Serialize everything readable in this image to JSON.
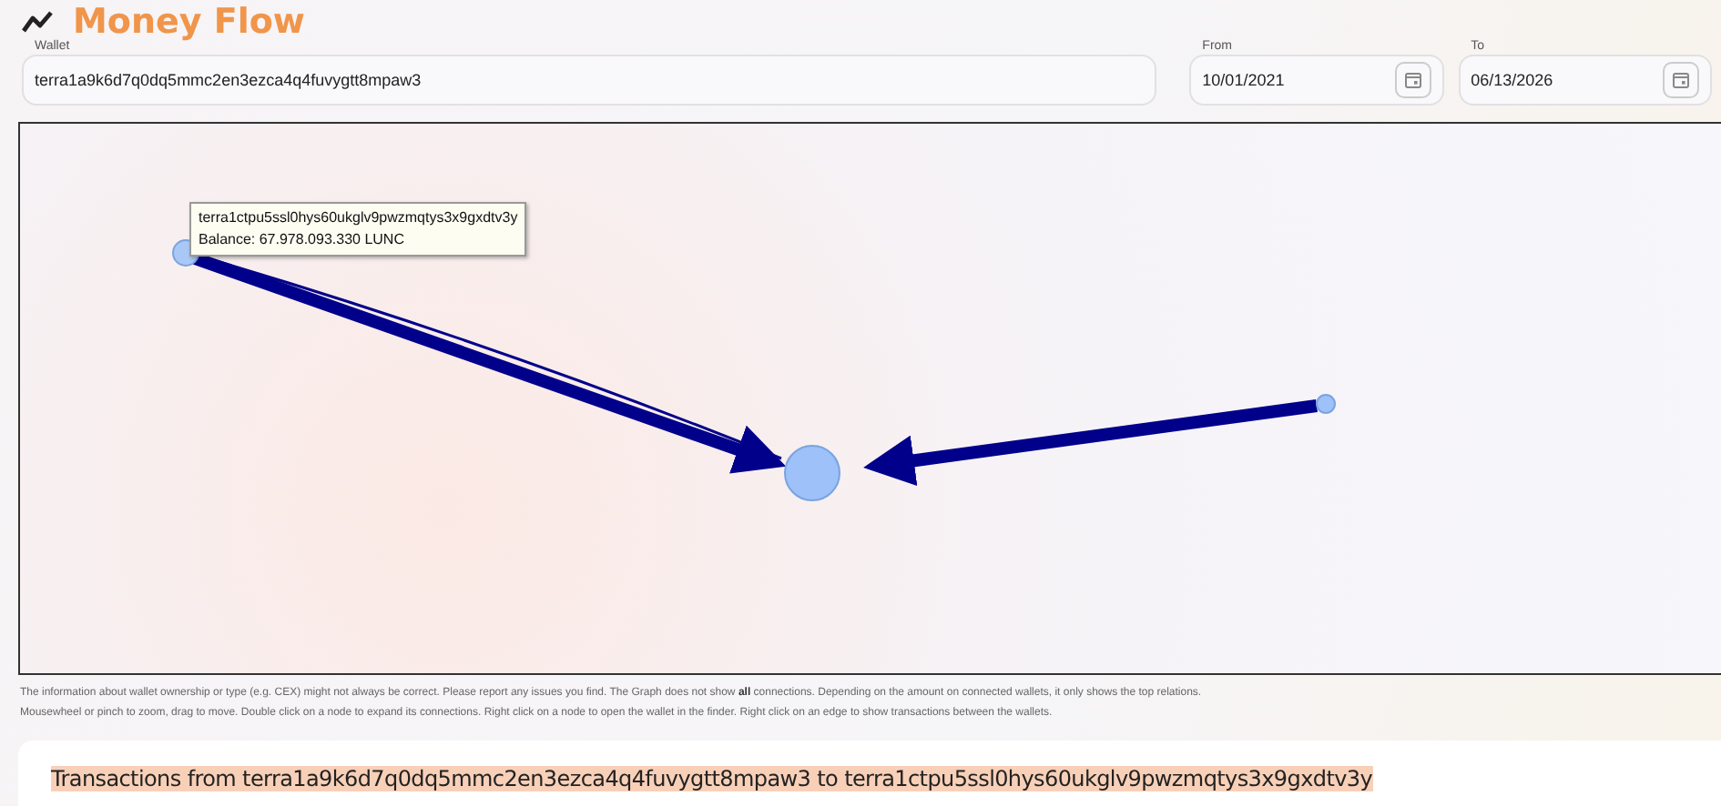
{
  "header": {
    "title": "Money Flow"
  },
  "wallet": {
    "label": "Wallet",
    "value": "terra1a9k6d7q0dq5mmc2en3ezca4q4fuvygtt8mpaw3"
  },
  "dates": [
    {
      "label": "From",
      "value": "10/01/2021"
    },
    {
      "label": "To",
      "value": "06/13/2026"
    }
  ],
  "graph": {
    "tooltip": {
      "address": "terra1ctpu5ssl0hys60ukglv9pwzmqtys3x9gxdtv3y",
      "balance": "Balance: 67.978.093.330 LUNC"
    }
  },
  "notes": [
    "The information about wallet ownership or type (e.g. CEX) might not always be correct. Please report any issues you find. The Graph does not show **all** connections. Depending on the amount on connected wallets, it only shows the top relations.",
    "Mousewheel or pinch to zoom, drag to move. Double click on a node to expand its connections. Right click on a node to open the wallet in the finder. Right click on an edge to show transactions between the wallets."
  ],
  "transactions": {
    "title": "Transactions from terra1a9k6d7q0dq5mmc2en3ezca4q4fuvygtt8mpaw3 to terra1ctpu5ssl0hys60ukglv9pwzmqtys3x9gxdtv3y"
  }
}
